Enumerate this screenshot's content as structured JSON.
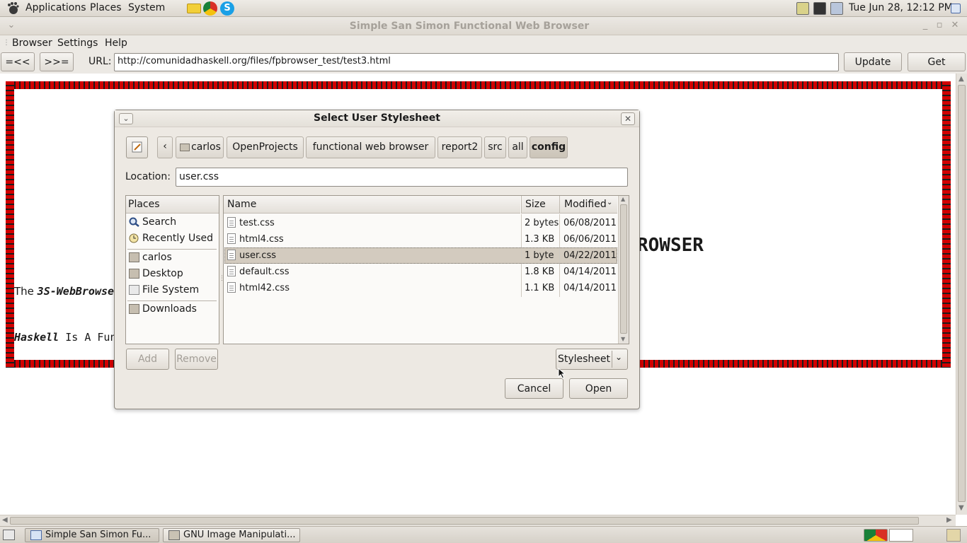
{
  "top_panel": {
    "menus": [
      "Applications",
      "Places",
      "System"
    ],
    "clock": "Tue Jun 28, 12:12 PM"
  },
  "window": {
    "title": "Simple San Simon Functional Web Browser",
    "menu": [
      "Browser",
      "Settings",
      "Help"
    ]
  },
  "toolbar": {
    "back_label": "=<<",
    "forward_label": ">>=",
    "url_label": "URL:",
    "url_value": "http://comunidadhaskell.org/files/fpbrowser_test/test3.html",
    "update_label": "Update",
    "get_label": "Get"
  },
  "page": {
    "heading_fragment": "ROWSER",
    "line1_prefix": "The ",
    "line1_bold": "3S-WebBrowse",
    "line2_bold": "Haskell",
    "line2_rest": " Is A Fun"
  },
  "dialog": {
    "title": "Select User Stylesheet",
    "breadcrumbs": [
      "carlos",
      "OpenProjects",
      "functional web browser",
      "report2",
      "src",
      "all",
      "config"
    ],
    "active_crumb": "config",
    "location_label": "Location:",
    "location_value": "user.css",
    "places_header": "Places",
    "places": [
      {
        "label": "Search",
        "icon": "search-icon"
      },
      {
        "label": "Recently Used",
        "icon": "clock-icon"
      },
      {
        "label": "carlos",
        "icon": "home-folder-icon"
      },
      {
        "label": "Desktop",
        "icon": "desktop-folder-icon"
      },
      {
        "label": "File System",
        "icon": "drive-icon"
      },
      {
        "label": "Downloads",
        "icon": "folder-icon"
      }
    ],
    "columns": {
      "name": "Name",
      "size": "Size",
      "modified": "Modified"
    },
    "files": [
      {
        "name": "test.css",
        "size": "2 bytes",
        "modified": "06/08/2011"
      },
      {
        "name": "html4.css",
        "size": "1.3 KB",
        "modified": "06/06/2011"
      },
      {
        "name": "user.css",
        "size": "1 byte",
        "modified": "04/22/2011"
      },
      {
        "name": "default.css",
        "size": "1.8 KB",
        "modified": "04/14/2011"
      },
      {
        "name": "html42.css",
        "size": "1.1 KB",
        "modified": "04/14/2011"
      }
    ],
    "selected_file": "user.css",
    "add_label": "Add",
    "remove_label": "Remove",
    "filter_value": "Stylesheet",
    "cancel_label": "Cancel",
    "open_label": "Open"
  },
  "taskbar": {
    "items": [
      "Simple San Simon Fu...",
      "GNU Image Manipulati..."
    ]
  },
  "colors": {
    "stripe_red": "#d20000",
    "selection": "#d3cbbf"
  }
}
